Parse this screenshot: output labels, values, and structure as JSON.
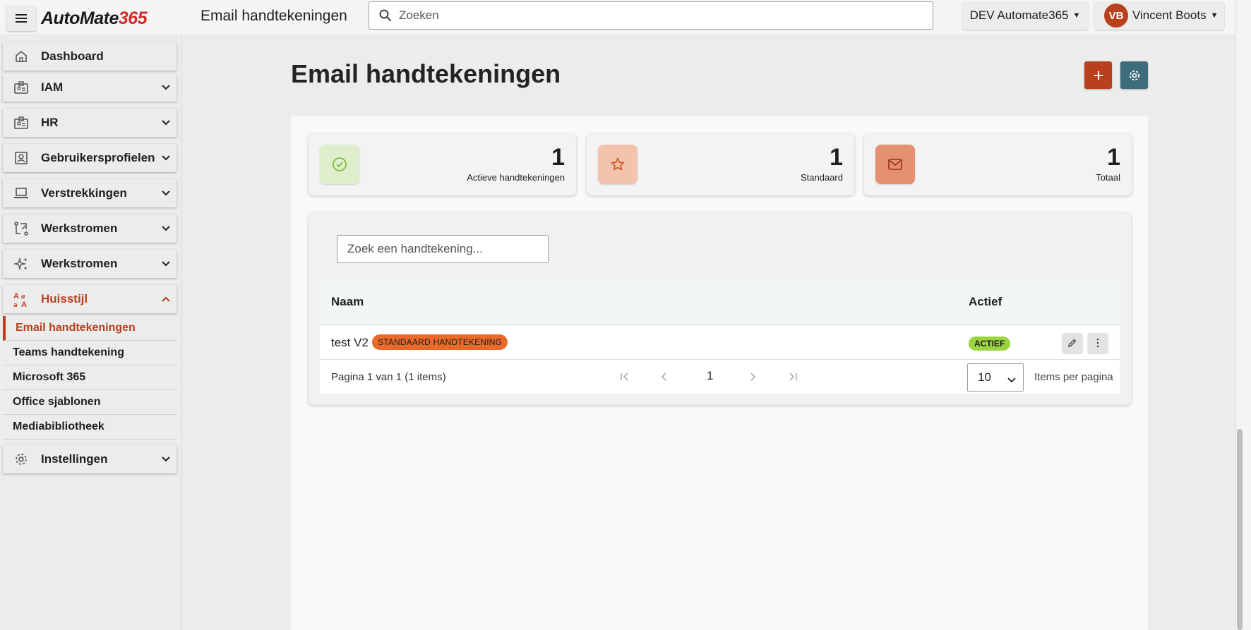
{
  "app": {
    "logo_part1": "AutoMate",
    "logo_part2": "365",
    "page_heading": "Email handtekeningen",
    "search_placeholder": "Zoeken",
    "tenant": "DEV Automate365",
    "user_initials": "VB",
    "user_name": "Vincent Boots"
  },
  "sidebar": {
    "items": [
      {
        "label": "Dashboard",
        "icon": "home-icon"
      },
      {
        "label": "IAM",
        "icon": "badge-icon"
      },
      {
        "label": "HR",
        "icon": "badge-icon"
      },
      {
        "label": "Gebruikersprofielen",
        "icon": "profile-icon"
      },
      {
        "label": "Verstrekkingen",
        "icon": "laptop-icon"
      },
      {
        "label": "Werkstromen",
        "icon": "flow-icon"
      },
      {
        "label": "Werkstromen",
        "icon": "sparkle-icon"
      },
      {
        "label": "Huisstijl",
        "icon": "typography-icon"
      },
      {
        "label": "Instellingen",
        "icon": "gear-icon"
      }
    ],
    "sub_items": [
      {
        "label": "Email handtekeningen"
      },
      {
        "label": "Teams handtekening"
      },
      {
        "label": "Microsoft 365"
      },
      {
        "label": "Office sjablonen"
      },
      {
        "label": "Mediabibliotheek"
      }
    ]
  },
  "main": {
    "title": "Email handtekeningen",
    "stats": [
      {
        "value": "1",
        "label": "Actieve handtekeningen",
        "icon": "check-circle-icon",
        "color": "#dfeecd"
      },
      {
        "value": "1",
        "label": "Standaard",
        "icon": "star-icon",
        "color": "#f3c3ad"
      },
      {
        "value": "1",
        "label": "Totaal",
        "icon": "mail-icon",
        "color": "#e59073"
      }
    ],
    "filter_placeholder": "Zoek een handtekening...",
    "table": {
      "columns": [
        "Naam",
        "Actief"
      ],
      "rows": [
        {
          "name": "test V2",
          "tag": "STANDAARD HANDTEKENING",
          "status": "ACTIEF"
        }
      ],
      "pagination_info": "Pagina 1 van 1 (1 items)",
      "current_page": "1",
      "page_size": "10",
      "items_per_page_label": "Items per pagina"
    }
  },
  "colors": {
    "accent": "#b8401d",
    "settings_button": "#3d6c7b",
    "active_badge": "#9bd43f",
    "standard_badge": "#e96a2a"
  }
}
